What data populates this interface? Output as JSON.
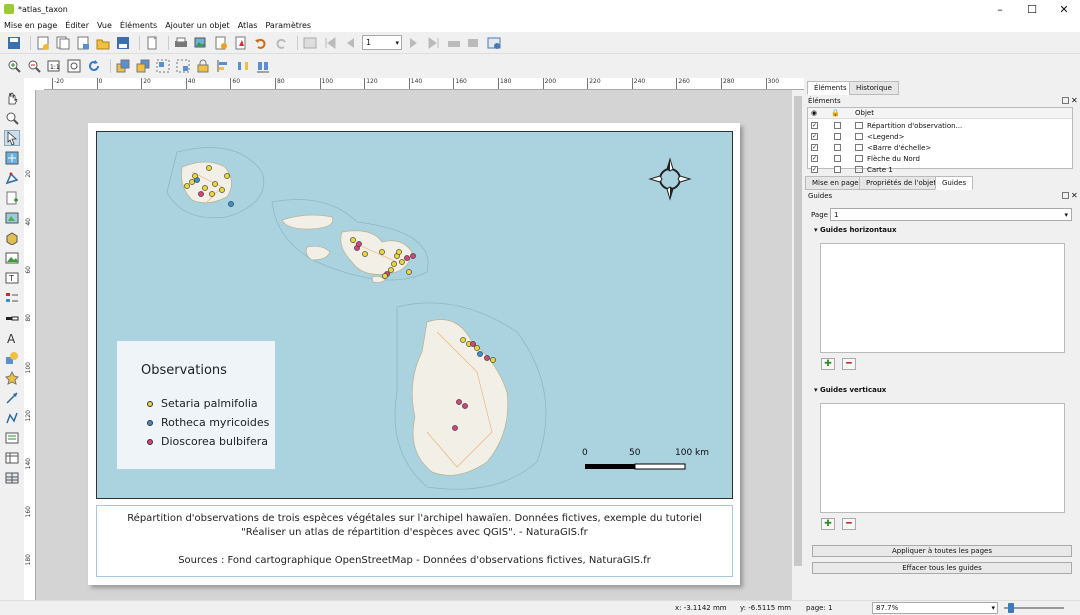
{
  "window": {
    "title": "*atlas_taxon",
    "minimize": "–",
    "maximize": "☐",
    "close": "✕"
  },
  "menu": [
    "Mise en page",
    "Éditer",
    "Vue",
    "Éléments",
    "Ajouter un objet",
    "Atlas",
    "Paramètres"
  ],
  "toolbar": {
    "atlas_page": "1"
  },
  "ruler": {
    "h_ticks": [
      "-20",
      "0",
      "20",
      "40",
      "60",
      "80",
      "100",
      "120",
      "140",
      "160",
      "180",
      "200",
      "220",
      "240",
      "260",
      "280",
      "300",
      "320"
    ],
    "v_ticks": [
      "20",
      "40",
      "60",
      "80",
      "100",
      "120",
      "140",
      "160",
      "180",
      "200"
    ]
  },
  "map": {
    "scale": {
      "l0": "0",
      "l50": "50",
      "l100": "100 km"
    },
    "legend": {
      "title": "Observations",
      "items": [
        {
          "name": "Setaria palmifolia",
          "color": "#e8d63a"
        },
        {
          "name": "Rotheca myricoides",
          "color": "#3a8fd0"
        },
        {
          "name": "Dioscorea bulbifera",
          "color": "#d0457a"
        }
      ]
    },
    "caption": {
      "line1": "Répartition d'observations de trois espèces végétales sur l'archipel hawaïen. Données fictives, exemple du tutoriel",
      "line2": "\"Réaliser un atlas de répartition d'espèces avec QGIS\". - NaturaGIS.fr",
      "line3": "Sources : Fond cartographique OpenStreetMap - Données d'observations fictives, NaturaGIS.fr"
    }
  },
  "right_panel": {
    "top_tabs": [
      "Éléments",
      "Historique"
    ],
    "elements_label": "Éléments",
    "col_obj": "Objet",
    "items": [
      {
        "name": "Répartition d'observation...",
        "checked": true
      },
      {
        "name": "<Legend>",
        "checked": true
      },
      {
        "name": "<Barre d'échelle>",
        "checked": true
      },
      {
        "name": "Flèche du Nord",
        "checked": true
      },
      {
        "name": "Carte 1",
        "checked": true
      }
    ],
    "bottom_tabs": [
      "Mise en page",
      "Propriétés de l'objet",
      "Guides"
    ],
    "guides_label": "Guides",
    "page_label": "Page",
    "page_value": "1",
    "h_guides": "Guides horizontaux",
    "v_guides": "Guides verticaux",
    "apply_all": "Appliquer à toutes les pages",
    "clear_all": "Effacer tous les guides"
  },
  "status": {
    "x": "x: -3.1142 mm",
    "y": "y: -6.5115 mm",
    "page": "page: 1",
    "zoom": "87.7%"
  }
}
